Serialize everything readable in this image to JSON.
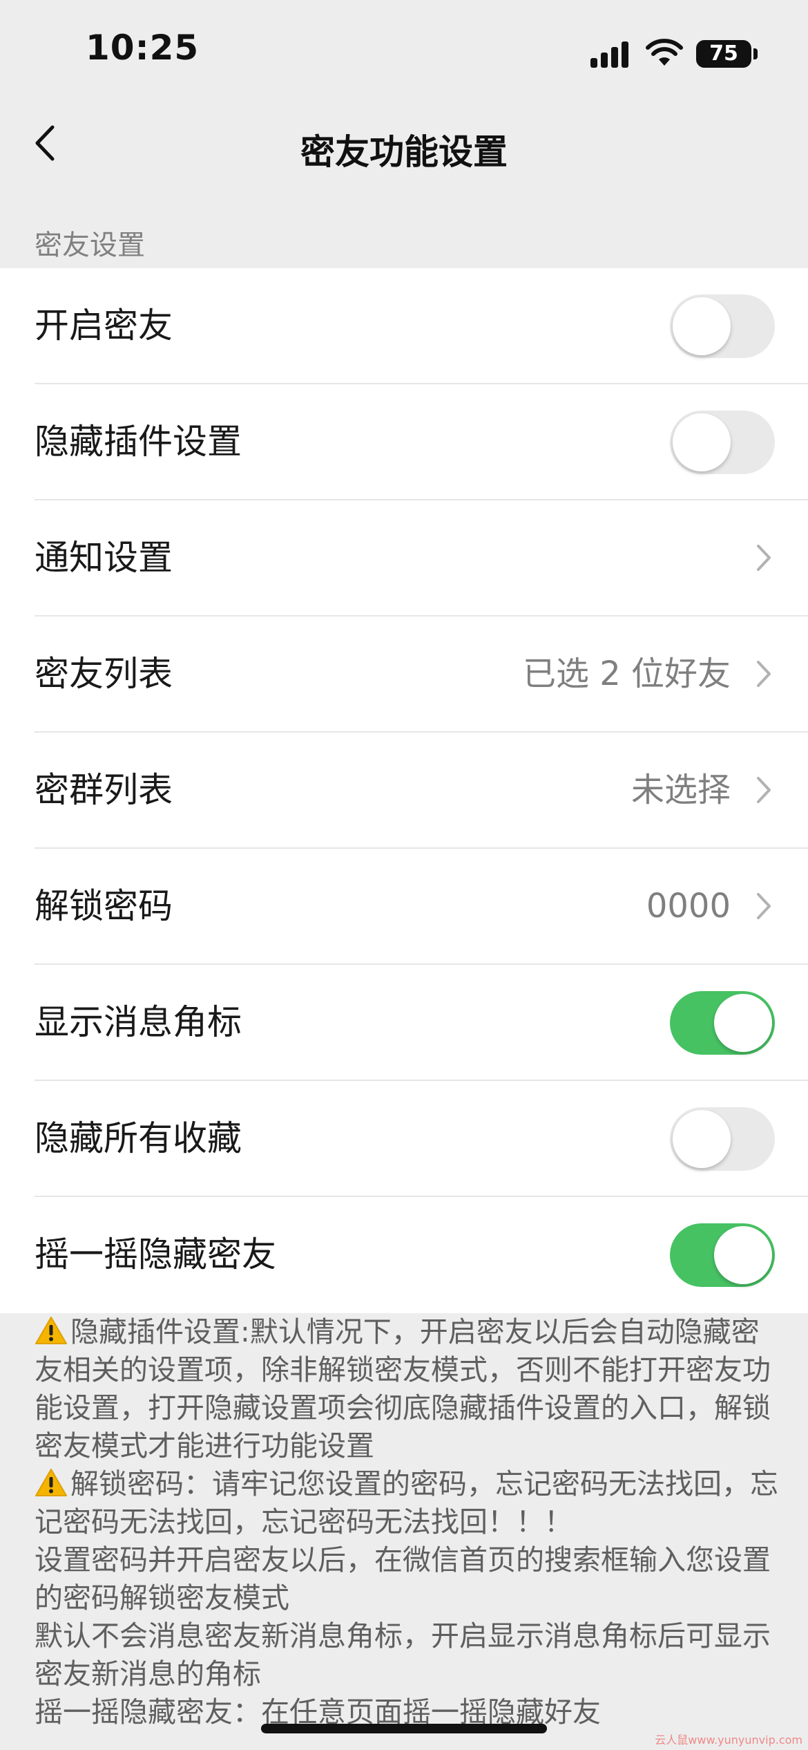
{
  "status_bar": {
    "time": "10:25",
    "battery": "75"
  },
  "nav": {
    "title": "密友功能设置"
  },
  "section": {
    "header": "密友设置"
  },
  "rows": [
    {
      "label": "开启密友",
      "type": "toggle",
      "on": false
    },
    {
      "label": "隐藏插件设置",
      "type": "toggle",
      "on": false
    },
    {
      "label": "通知设置",
      "type": "link",
      "value": ""
    },
    {
      "label": "密友列表",
      "type": "link",
      "value": "已选 2 位好友"
    },
    {
      "label": "密群列表",
      "type": "link",
      "value": "未选择"
    },
    {
      "label": "解锁密码",
      "type": "link",
      "value": "0000"
    },
    {
      "label": "显示消息角标",
      "type": "toggle",
      "on": true
    },
    {
      "label": "隐藏所有收藏",
      "type": "toggle",
      "on": false
    },
    {
      "label": "摇一摇隐藏密友",
      "type": "toggle",
      "on": true
    }
  ],
  "notes": {
    "p1": "隐藏插件设置:默认情况下，开启密友以后会自动隐藏密友相关的设置项，除非解锁密友模式，否则不能打开密友功能设置，打开隐藏设置项会彻底隐藏插件设置的入口，解锁密友模式才能进行功能设置",
    "p2": "解锁密码：请牢记您设置的密码，忘记密码无法找回，忘记密码无法找回，忘记密码无法找回！！！",
    "p3": "设置密码并开启密友以后，在微信首页的搜索框输入您设置的密码解锁密友模式",
    "p4": "默认不会消息密友新消息角标，开启显示消息角标后可显示密友新消息的角标",
    "p5": "摇一摇隐藏密友：在任意页面摇一摇隐藏好友"
  },
  "watermark": "云人鼠www.yunyunvip.com",
  "colors": {
    "toggle_on": "#46c263",
    "toggle_off": "#e9e9ea",
    "background": "#ededed"
  }
}
